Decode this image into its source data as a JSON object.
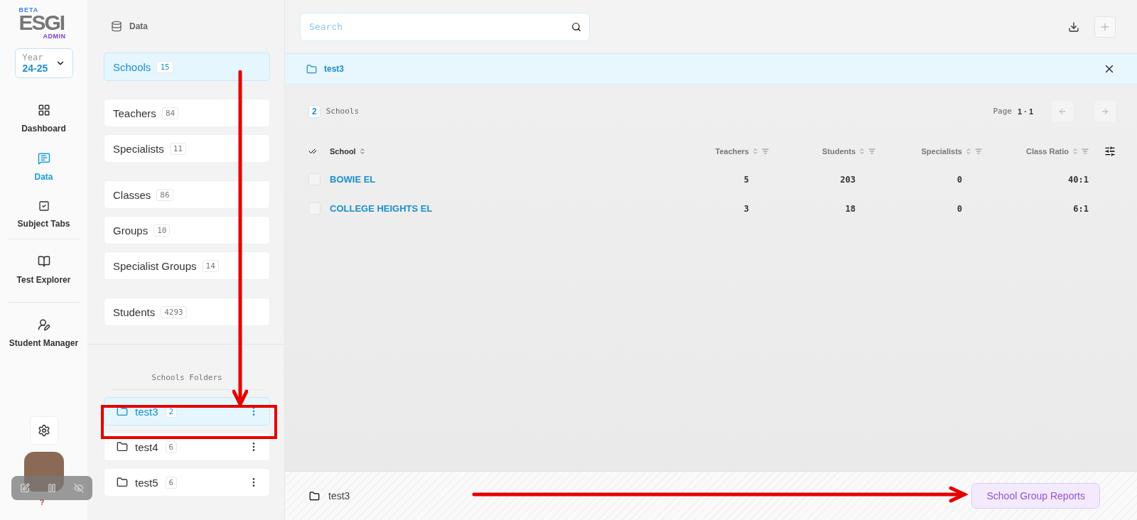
{
  "logo": {
    "tag": "BETA",
    "name": "ESGI",
    "sub": "ADMIN"
  },
  "year": {
    "label": "Year",
    "value": "24-25"
  },
  "nav": [
    {
      "label": "Dashboard",
      "selected": false
    },
    {
      "label": "Data",
      "selected": true
    },
    {
      "label": "Subject Tabs",
      "selected": false
    },
    {
      "label": "Test Explorer",
      "selected": false
    },
    {
      "label": "Student Manager",
      "selected": false
    }
  ],
  "recorder": {
    "help": "?"
  },
  "data_panel": {
    "title": "Data",
    "groups": [
      [
        {
          "label": "Schools",
          "count": "15",
          "selected": true
        }
      ],
      [
        {
          "label": "Teachers",
          "count": "84",
          "selected": false
        },
        {
          "label": "Specialists",
          "count": "11",
          "selected": false
        }
      ],
      [
        {
          "label": "Classes",
          "count": "86",
          "selected": false
        },
        {
          "label": "Groups",
          "count": "10",
          "selected": false
        },
        {
          "label": "Specialist Groups",
          "count": "14",
          "selected": false
        }
      ],
      [
        {
          "label": "Students",
          "count": "4293",
          "selected": false
        }
      ]
    ],
    "folders_title": "Schools Folders",
    "folders": [
      {
        "label": "test3",
        "count": "2",
        "selected": true
      },
      {
        "label": "test4",
        "count": "6",
        "selected": false
      },
      {
        "label": "test5",
        "count": "6",
        "selected": false
      }
    ]
  },
  "search": {
    "placeholder": "Search"
  },
  "folder_bar": {
    "label": "test3"
  },
  "summary": {
    "count": "2",
    "label": "Schools",
    "page_label": "Page",
    "page": "1",
    "separator": "·",
    "pages": "1"
  },
  "table": {
    "columns": [
      {
        "label": "School",
        "filter": false
      },
      {
        "label": "Teachers",
        "filter": true
      },
      {
        "label": "Students",
        "filter": true
      },
      {
        "label": "Specialists",
        "filter": true
      },
      {
        "label": "Class Ratio",
        "filter": true
      }
    ],
    "rows": [
      {
        "cells": [
          "BOWIE EL",
          "5",
          "203",
          "0",
          "40:1"
        ],
        "checked": false
      },
      {
        "cells": [
          "COLLEGE HEIGHTS EL",
          "3",
          "18",
          "0",
          "6:1"
        ],
        "checked": false
      }
    ]
  },
  "footer": {
    "folder": "test3",
    "button": "School Group Reports"
  },
  "annotations": [
    {
      "kind": "down-arrow"
    },
    {
      "kind": "frame"
    },
    {
      "kind": "right-arrow"
    }
  ]
}
